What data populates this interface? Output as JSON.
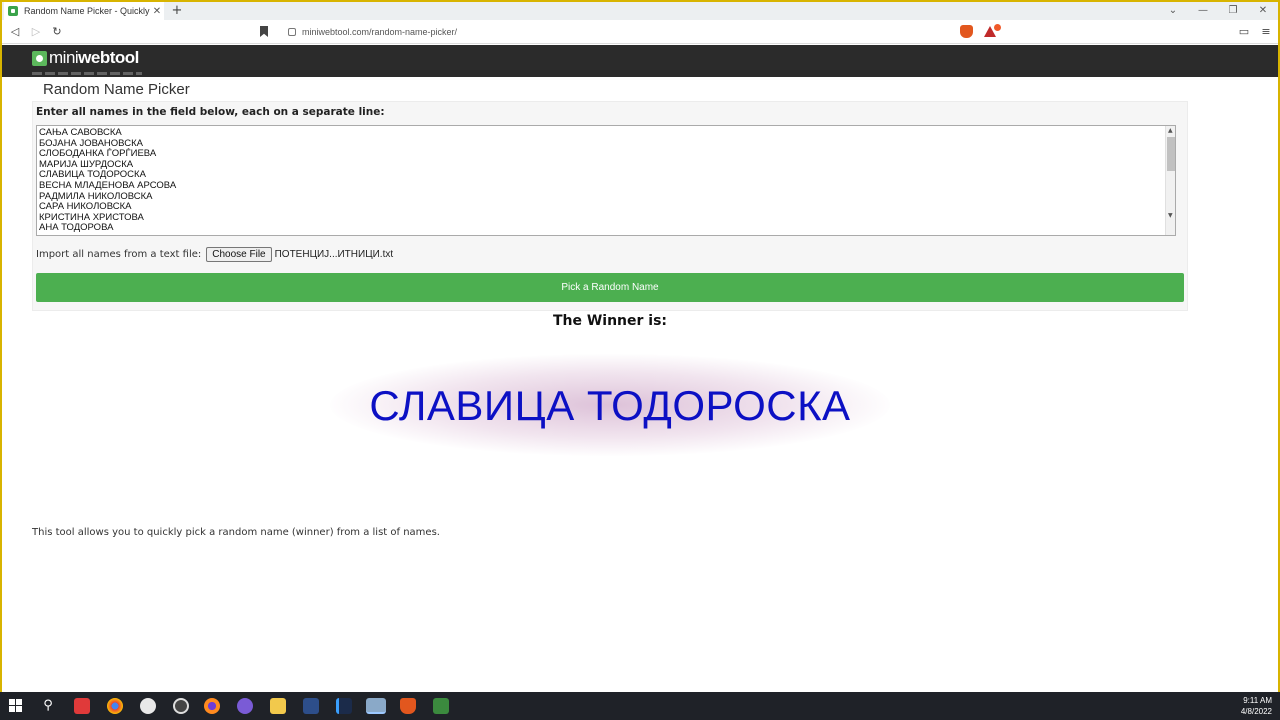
{
  "browser": {
    "tab_title": "Random Name Picker - Quickly P",
    "tab_close": "✕",
    "new_tab": "+",
    "url": "miniwebtool.com/random-name-picker/",
    "badge_count": "1"
  },
  "site": {
    "logo_part1": "mini",
    "logo_part2": "webtool"
  },
  "tool": {
    "title": "Random Name Picker",
    "field_label": "Enter all names in the field below, each on a separate line:",
    "names": [
      "САЊА САВОВСКА",
      "БОЈАНА ЈОВАНОВСКА",
      "СЛОБОДАНКА ЃОРЃИЕВА",
      "МАРИЈА ШУРДОСКА",
      "СЛАВИЦА ТОДОРОСКА",
      "ВЕСНА МЛАДЕНОВА АРСОВА",
      "РАДМИЛА НИКОЛОВСКА",
      "САРА НИКОЛОВСКА",
      "КРИСТИНА ХРИСТОВА",
      "АНА ТОДОРОВА"
    ],
    "import_label": "Import all names from a text file:",
    "choose_file_label": "Choose File",
    "file_name": "ПОТЕНЦИЈ...ИТНИЦИ.txt",
    "pick_button": "Pick a Random Name"
  },
  "result": {
    "winner_label": "The Winner is:",
    "winner_name": "СЛАВИЦА ТОДОРОСКА"
  },
  "description": "This tool allows you to quickly pick a random name (winner) from a list of names.",
  "taskbar": {
    "time": "9:11 AM",
    "date": "4/8/2022"
  },
  "colors": {
    "accent_green": "#4caf50",
    "winner_blue": "#0c10c4",
    "header_dark": "#2b2b2b"
  }
}
